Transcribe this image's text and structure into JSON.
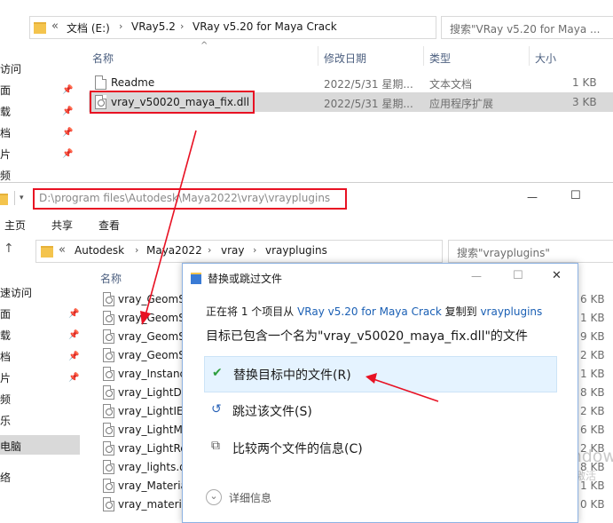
{
  "top_window": {
    "address": {
      "chevron": "«",
      "crumbs": [
        "文档 (E:)",
        "VRay5.2",
        "VRay v5.20 for Maya Crack"
      ],
      "separators": [
        "›",
        "›",
        "›"
      ]
    },
    "search_placeholder": "搜索\"VRay v5.20 for Maya ...",
    "sidebar": [
      "访问",
      "面",
      "载",
      "档",
      "片",
      "频"
    ],
    "columns": {
      "name": "名称",
      "date": "修改日期",
      "type": "类型",
      "size": "大小"
    },
    "sort_arrow": "^",
    "files": [
      {
        "name": "Readme",
        "date": "2022/5/31 星期...",
        "type": "文本文档",
        "size": "1 KB"
      },
      {
        "name": "vray_v50020_maya_fix.dll",
        "date": "2022/5/31 星期...",
        "type": "应用程序扩展",
        "size": "3 KB"
      }
    ]
  },
  "bottom_window": {
    "path_text": "D:\\program files\\Autodesk\\Maya2022\\vray\\vrayplugins",
    "title_controls": {
      "minimize": "—",
      "maximize": "☐"
    },
    "ribbon": [
      "主页",
      "共享",
      "查看"
    ],
    "address": {
      "chevron": "«",
      "crumbs": [
        "Autodesk",
        "Maya2022",
        "vray",
        "vrayplugins"
      ],
      "separators": [
        "›",
        "›",
        "›"
      ]
    },
    "search_placeholder": "搜索\"vrayplugins\"",
    "column_name": "名称",
    "sidebar": [
      "速访问",
      "面",
      "载",
      "档",
      "片",
      "频",
      "乐",
      "电脑",
      "络"
    ],
    "files": [
      "vray_GeomS",
      "vray_GeomS",
      "vray_GeomS",
      "vray_GeomS",
      "vray_Instanc",
      "vray_LightDc",
      "vray_LightIES",
      "vray_LightMe",
      "vray_LightRe",
      "vray_lights.d",
      "vray_Materia",
      "vray_materia"
    ],
    "sizes": [
      "6 KB",
      "1 KB",
      "9 KB",
      "2 KB",
      "1 KB",
      "8 KB",
      "2 KB",
      "6 KB",
      "2 KB",
      "8 KB",
      "1 KB",
      "0 KB"
    ]
  },
  "dialog": {
    "title": "替换或跳过文件",
    "controls": {
      "minimize": "—",
      "maximize": "☐",
      "close": "✕"
    },
    "info_prefix": "正在将 1 个项目从 ",
    "source": "VRay v5.20 for Maya Crack",
    "info_middle": " 复制到 ",
    "dest": "vrayplugins",
    "message": "目标已包含一个名为\"vray_v50020_maya_fix.dll\"的文件",
    "options": [
      {
        "icon": "check-icon",
        "label": "替换目标中的文件(R)",
        "icon_char": "✔"
      },
      {
        "icon": "skip-icon",
        "label": "跳过该文件(S)",
        "icon_char": "↺"
      },
      {
        "icon": "compare-icon",
        "label": "比较两个文件的信息(C)",
        "icon_char": "⧉"
      }
    ],
    "details": "详细信息",
    "details_chevron": "⌄"
  },
  "watermark": {
    "line1": "激活 Windows",
    "line2": "转到\"设置\"以激活"
  },
  "colors": {
    "highlight_red": "#e81123",
    "link_blue": "#1a5fb4",
    "selected_row": "#cce8ff",
    "option_bg": "#e5f3ff"
  }
}
